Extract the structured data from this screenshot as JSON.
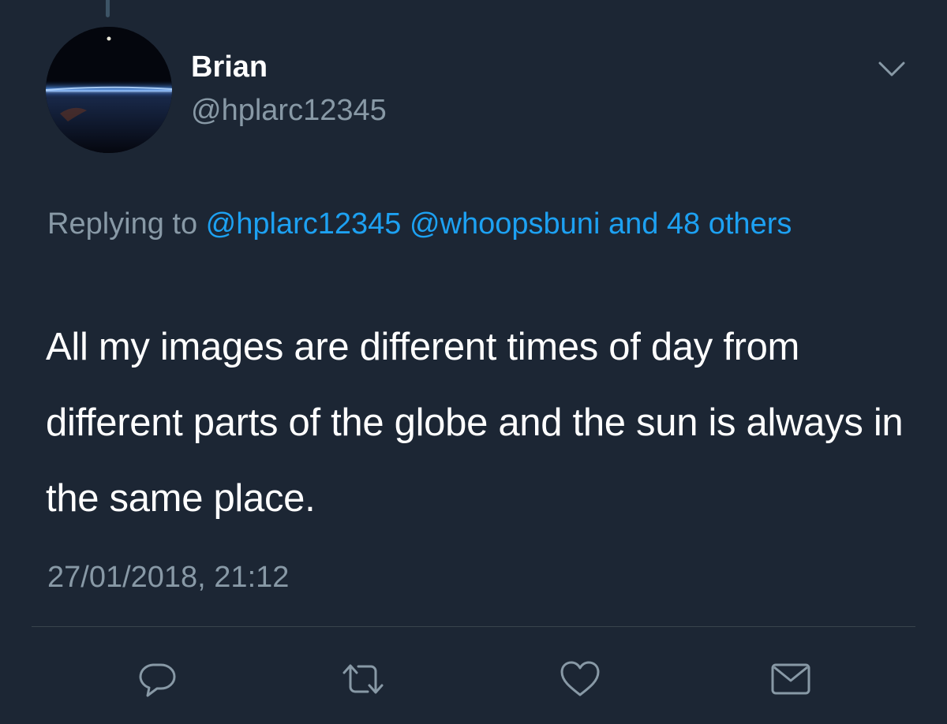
{
  "author": {
    "name": "Brian",
    "handle": "@hplarc12345",
    "avatar_icon": "earth-horizon-avatar"
  },
  "reply_context": {
    "prefix": "Replying to ",
    "mentions": [
      "@hplarc12345",
      "@whoopsbuni"
    ],
    "and_more": "and 48 others"
  },
  "tweet": {
    "text": "All my images are different times of day from different parts of the globe and the sun is always in the same place.",
    "timestamp": "27/01/2018, 21:12"
  },
  "actions": [
    {
      "icon": "reply-icon"
    },
    {
      "icon": "retweet-icon"
    },
    {
      "icon": "like-icon"
    },
    {
      "icon": "direct-message-icon"
    }
  ],
  "colors": {
    "background": "#1c2634",
    "text": "#ffffff",
    "secondary_text": "#8899a6",
    "link": "#1da1f2",
    "divider": "#38444d"
  }
}
